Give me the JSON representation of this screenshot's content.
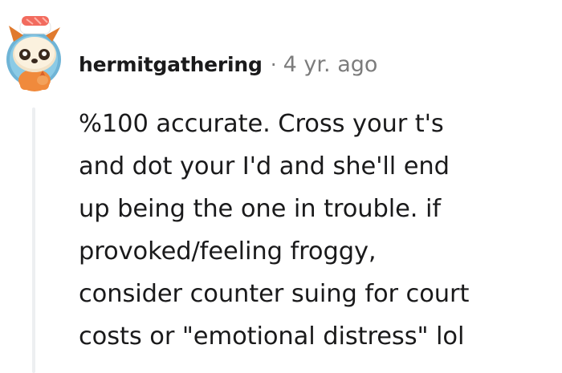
{
  "comment": {
    "author": "hermitgathering",
    "separator": "·",
    "timestamp": "4 yr. ago",
    "avatar_icon": "snoo-avatar-icon",
    "body_lines": [
      "%100 accurate. Cross your t's",
      "and dot your I'd and she'll end",
      "up being the one in trouble. if",
      "provoked/feeling froggy,",
      "consider counter suing for court",
      "costs or \"emotional distress\" lol"
    ]
  }
}
